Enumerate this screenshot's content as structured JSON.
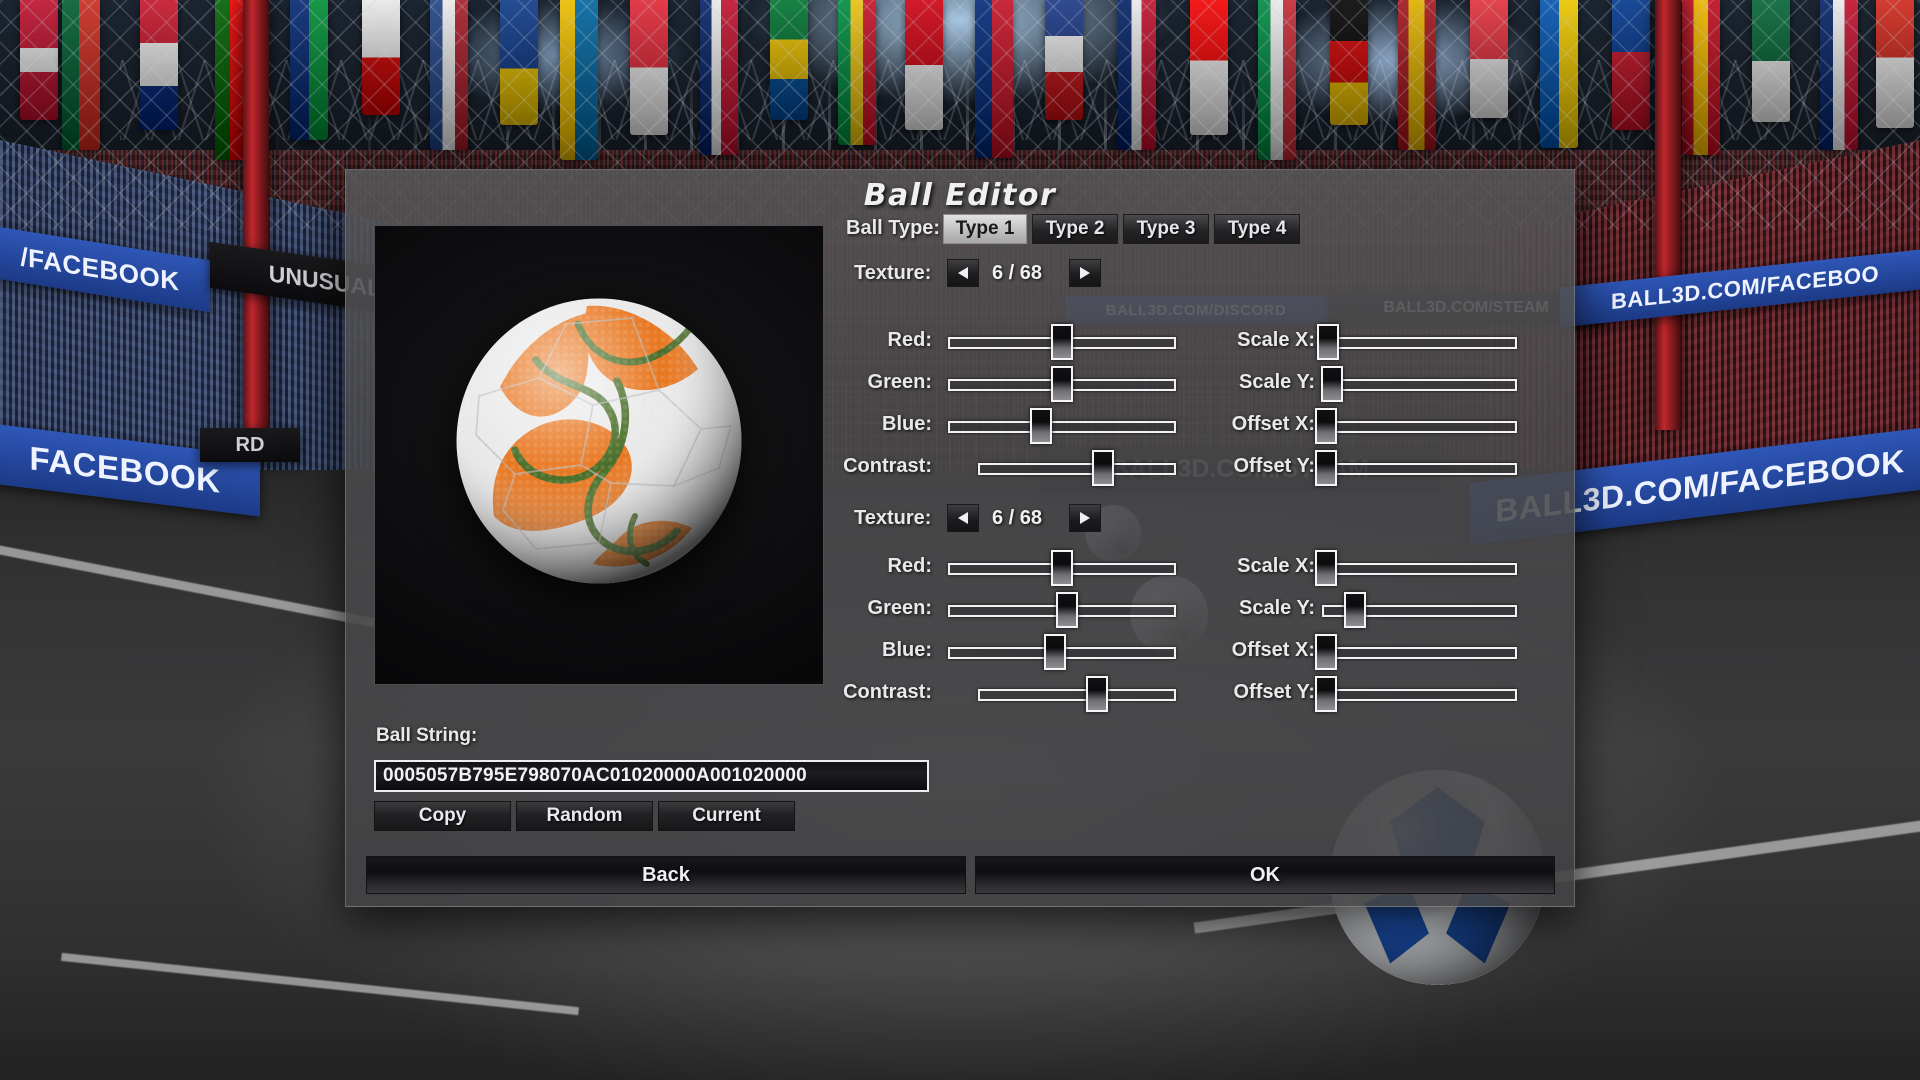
{
  "dialog": {
    "title": "Ball Editor",
    "ball_type_label": "Ball Type:",
    "ball_types": [
      {
        "label": "Type 1",
        "selected": true
      },
      {
        "label": "Type 2",
        "selected": false
      },
      {
        "label": "Type 3",
        "selected": false
      },
      {
        "label": "Type 4",
        "selected": false
      }
    ],
    "texture_sections": [
      {
        "texture_label": "Texture:",
        "texture_value": "6 / 68",
        "prev_arrow": "◀",
        "next_arrow": "▶",
        "left_sliders": [
          {
            "label": "Red:",
            "pct": 50
          },
          {
            "label": "Green:",
            "pct": 50
          },
          {
            "label": "Blue:",
            "pct": 41
          },
          {
            "label": "Contrast:",
            "pct": 63
          }
        ],
        "right_sliders": [
          {
            "label": "Scale X:",
            "pct": 3
          },
          {
            "label": "Scale Y:",
            "pct": 5
          },
          {
            "label": "Offset X:",
            "pct": 2
          },
          {
            "label": "Offset Y:",
            "pct": 2
          }
        ]
      },
      {
        "texture_label": "Texture:",
        "texture_value": "6 / 68",
        "prev_arrow": "◀",
        "next_arrow": "▶",
        "left_sliders": [
          {
            "label": "Red:",
            "pct": 50
          },
          {
            "label": "Green:",
            "pct": 52
          },
          {
            "label": "Blue:",
            "pct": 47
          },
          {
            "label": "Contrast:",
            "pct": 60
          }
        ],
        "right_sliders": [
          {
            "label": "Scale X:",
            "pct": 2
          },
          {
            "label": "Scale Y:",
            "pct": 17
          },
          {
            "label": "Offset X:",
            "pct": 2
          },
          {
            "label": "Offset Y:",
            "pct": 2
          }
        ]
      }
    ],
    "ball_string_label": "Ball String:",
    "ball_string_value": "0005057B795E798070AC01020000A001020000",
    "string_buttons": [
      "Copy",
      "Random",
      "Current"
    ],
    "footer_buttons": [
      "Back",
      "OK"
    ]
  },
  "preview": {
    "ball_base_color": "#e8e8e8",
    "ball_accent_color": "#e8761f",
    "ball_outline_color": "#4a6e28"
  },
  "background": {
    "adverts": [
      {
        "text": "/FACEBOOK"
      },
      {
        "text": "UNUSUAL"
      },
      {
        "text": "BALL3D.COM/DISCORD"
      },
      {
        "text": "BALL3D.COM/STEAM"
      },
      {
        "text": "FACEBOOK"
      },
      {
        "text": "BALL3D.COM/FACEBOOK"
      },
      {
        "text": "BALL3D.COM/FACEBOO"
      },
      {
        "text": "BALL3D.COM/STEAM"
      },
      {
        "text": "RD"
      }
    ]
  }
}
